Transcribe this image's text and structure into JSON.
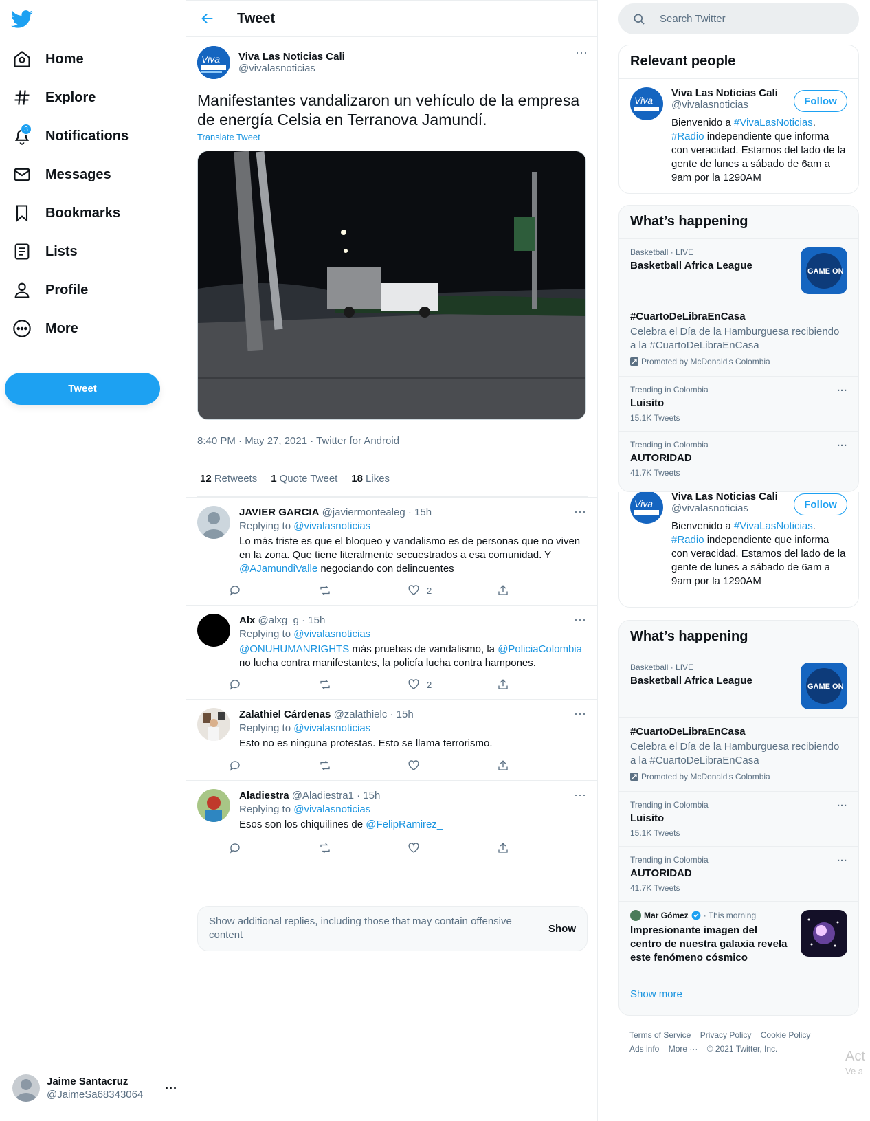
{
  "nav": {
    "items": [
      {
        "label": "Home",
        "icon": "home-icon"
      },
      {
        "label": "Explore",
        "icon": "hashtag-icon"
      },
      {
        "label": "Notifications",
        "icon": "bell-icon",
        "badge": "3"
      },
      {
        "label": "Messages",
        "icon": "mail-icon"
      },
      {
        "label": "Bookmarks",
        "icon": "bookmark-icon"
      },
      {
        "label": "Lists",
        "icon": "list-icon"
      },
      {
        "label": "Profile",
        "icon": "person-icon"
      },
      {
        "label": "More",
        "icon": "more-circle-icon"
      }
    ],
    "tweet_button": "Tweet",
    "account": {
      "name": "Jaime Santacruz",
      "handle": "@JaimeSa68343064"
    }
  },
  "header": {
    "title": "Tweet"
  },
  "tweet": {
    "author_name": "Viva Las Noticias Cali",
    "author_handle": "@vivalasnoticias",
    "text": "Manifestantes vandalizaron un vehículo de la empresa de energía Celsia en Terranova Jamundí.",
    "translate": "Translate Tweet",
    "meta": "8:40 PM · May 27, 2021 · Twitter for Android",
    "stats": {
      "retweets_count": "12",
      "retweets_label": "Retweets",
      "quotes_count": "1",
      "quotes_label": "Quote Tweet",
      "likes_count": "18",
      "likes_label": "Likes"
    }
  },
  "replies": [
    {
      "name": "JAVIER GARCIA",
      "handle": "@javiermontealeg · 15h",
      "replying_prefix": "Replying to",
      "replying_to": "@vivalasnoticias",
      "text_parts": [
        "Lo más triste es que el bloqueo y vandalismo es de personas que no viven en la zona. Que tiene literalmente secuestrados a esa comunidad. Y ",
        "@AJamundiValle",
        " negociando con delincuentes"
      ],
      "likes": "2"
    },
    {
      "name": "Alx",
      "handle": "@alxg_g · 15h",
      "replying_prefix": "Replying to",
      "replying_to": "@vivalasnoticias",
      "text_parts": [
        "@ONUHUMANRIGHTS",
        " más pruebas de vandalismo, la ",
        "@PoliciaColombia",
        " no lucha contra manifestantes, la policía lucha contra hampones."
      ],
      "likes": "2"
    },
    {
      "name": "Zalathiel Cárdenas",
      "handle": "@zalathielc · 15h",
      "replying_prefix": "Replying to",
      "replying_to": "@vivalasnoticias",
      "text_parts": [
        "Esto no es ninguna protestas. Esto se llama terrorismo."
      ],
      "likes": ""
    },
    {
      "name": "Aladiestra",
      "handle": "@Aladiestra1 · 15h",
      "replying_prefix": "Replying to",
      "replying_to": "@vivalasnoticias",
      "text_parts": [
        "Esos son los chiquilines de ",
        "@FelipRamirez_"
      ],
      "likes": ""
    }
  ],
  "show_more_replies": {
    "text": "Show additional replies, including those that may contain offensive content",
    "button": "Show"
  },
  "search": {
    "placeholder": "Search Twitter"
  },
  "relevant_people": {
    "title": "Relevant people",
    "name": "Viva Las Noticias Cali",
    "handle": "@vivalasnoticias",
    "follow": "Follow",
    "bio_parts": [
      "Bienvenido a ",
      "#VivaLasNoticias",
      ". ",
      "#Radio",
      " independiente que informa con veracidad. Estamos del lado de la gente de lunes a sábado de 6am a 9am por la 1290AM"
    ]
  },
  "happening": {
    "title": "What’s happening",
    "items": [
      {
        "context": "Basketball · LIVE",
        "title": "Basketball Africa League"
      },
      {
        "title": "#CuartoDeLibraEnCasa",
        "desc": "Celebra el Día de la Hamburguesa recibiendo a la #CuartoDeLibraEnCasa",
        "promoted": "Promoted by McDonald's Colombia"
      },
      {
        "context": "Trending in Colombia",
        "title": "Luisito",
        "count": "15.1K Tweets"
      },
      {
        "context": "Trending in Colombia",
        "title": "AUTORIDAD",
        "count": "41.7K Tweets"
      },
      {
        "author": "Mar Gómez",
        "time": "· This morning",
        "title": "Impresionante imagen del centro de nuestra galaxia revela este fenómeno cósmico"
      }
    ],
    "show_more": "Show more"
  },
  "footer": {
    "links": [
      "Terms of Service",
      "Privacy Policy",
      "Cookie Policy",
      "Ads info",
      "More ···"
    ],
    "copyright": "© 2021 Twitter, Inc."
  },
  "overlay": {
    "line1": "Act",
    "line2": "Ve a"
  },
  "colors": {
    "accent": "#1da1f2",
    "link": "#1b95e0",
    "muted": "#5b7083",
    "text": "#0f1419"
  }
}
